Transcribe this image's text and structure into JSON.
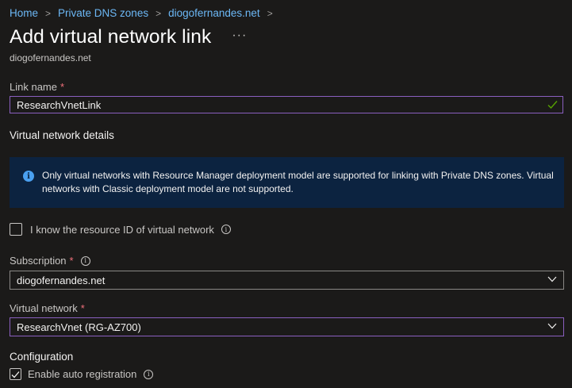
{
  "breadcrumb": {
    "items": [
      "Home",
      "Private DNS zones",
      "diogofernandes.net"
    ],
    "separator": ">"
  },
  "header": {
    "title": "Add virtual network link",
    "more_label": "···",
    "subtitle": "diogofernandes.net"
  },
  "link_name": {
    "label": "Link name",
    "required_marker": "*",
    "value": "ResearchVnetLink"
  },
  "virtual_network_details": {
    "heading": "Virtual network details",
    "banner_icon": "i",
    "banner_text": "Only virtual networks with Resource Manager deployment model are supported for linking with Private DNS zones. Virtual networks with Classic deployment model are not supported.",
    "resource_id_checkbox_label": "I know the resource ID of virtual network",
    "resource_id_checked": false
  },
  "subscription": {
    "label": "Subscription",
    "required_marker": "*",
    "value": "diogofernandes.net"
  },
  "virtual_network": {
    "label": "Virtual network",
    "required_marker": "*",
    "value": "ResearchVnet (RG-AZ700)"
  },
  "configuration": {
    "heading": "Configuration",
    "auto_registration_label": "Enable auto registration",
    "auto_registration_checked": true
  },
  "info_icon_glyph": "i",
  "colors": {
    "background": "#1b1a19",
    "link": "#6cb8f6",
    "focus_border": "#8a5fbf",
    "required": "#f1707b",
    "banner_bg": "#0c2340",
    "valid_check": "#57a300"
  }
}
